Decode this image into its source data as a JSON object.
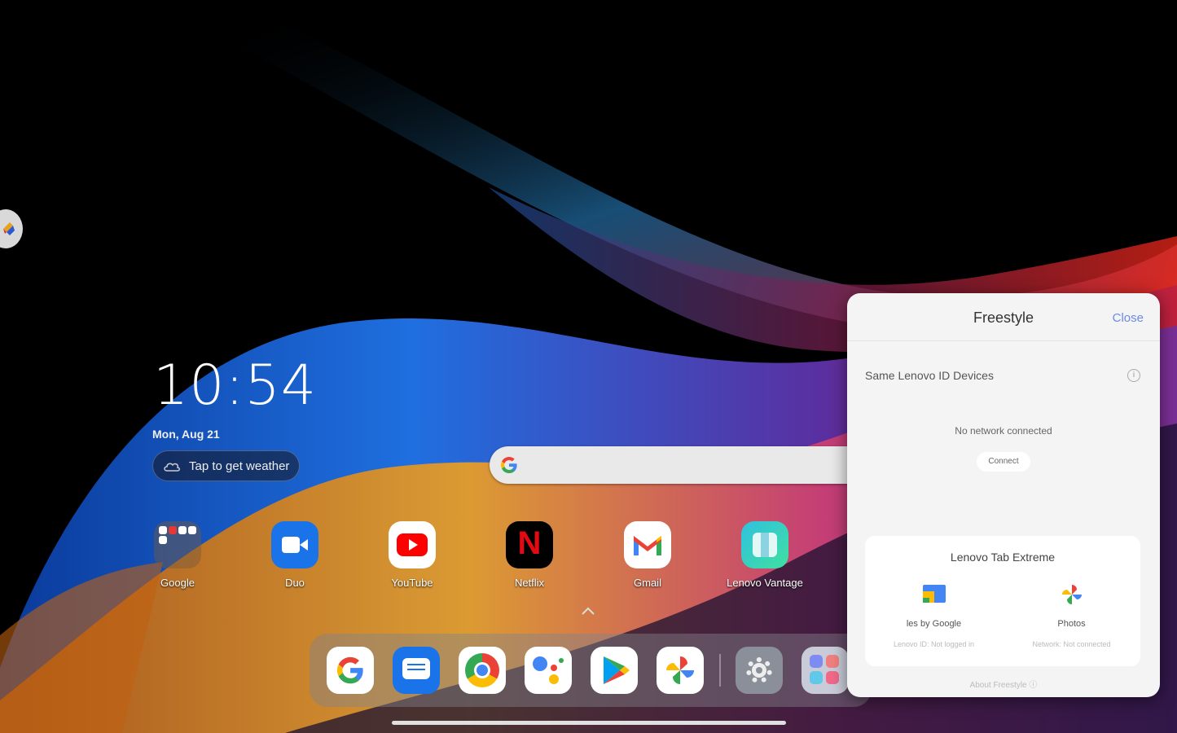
{
  "clock": {
    "time": "10:54",
    "date": "Mon, Aug 21"
  },
  "weather": {
    "label": "Tap to get weather",
    "icon": "cloud-icon"
  },
  "search": {
    "icon": "google-g-icon"
  },
  "apps": [
    {
      "label": "Google",
      "icon": "google-folder-icon"
    },
    {
      "label": "Duo",
      "icon": "duo-icon"
    },
    {
      "label": "YouTube",
      "icon": "youtube-icon"
    },
    {
      "label": "Netflix",
      "icon": "netflix-icon"
    },
    {
      "label": "Gmail",
      "icon": "gmail-icon"
    },
    {
      "label": "Lenovo Vantage",
      "icon": "lenovo-vantage-icon"
    }
  ],
  "dock": [
    "google-icon",
    "messages-icon",
    "chrome-icon",
    "assistant-icon",
    "play-store-icon",
    "photos-icon",
    "settings-icon",
    "app-drawer-icon"
  ],
  "freestyle": {
    "title": "Freestyle",
    "close": "Close",
    "section": "Same Lenovo ID Devices",
    "no_network": "No network connected",
    "connect": "Connect",
    "device": {
      "name": "Lenovo Tab Extreme",
      "items": [
        {
          "label": "les by Google",
          "status": "Lenovo ID: Not logged in",
          "icon": "files-icon"
        },
        {
          "label": "Photos",
          "status": "Network: Not connected",
          "icon": "photos-pinwheel-icon"
        }
      ]
    },
    "about": "About Freestyle"
  },
  "colors": {
    "accent_link": "#6a8ae8",
    "panel_bg": "#f4f4f4"
  }
}
